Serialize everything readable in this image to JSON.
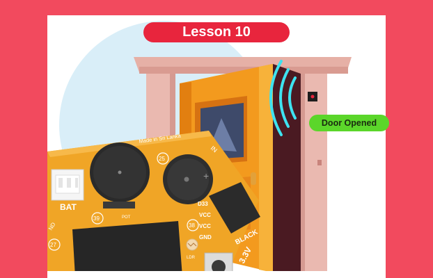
{
  "lesson_title": "Lesson 10",
  "status_badge": "Door Opened",
  "board": {
    "brand_text": "Made in Sri Lanka",
    "bat_label": "BAT",
    "pot_label": "POT",
    "ldr_label": "LDR",
    "pin_25": "25",
    "pin_39": "39",
    "pin_38": "38",
    "pin_27": "27",
    "pin_d33": "D33",
    "pin_vcc1": "VCC",
    "pin_vcc2": "VCC",
    "pin_gnd": "GND",
    "pin_nd": "ND",
    "black_label": "BLACK",
    "voltage_label": "3.3V",
    "in_label": "IN"
  },
  "colors": {
    "page_bg": "#f24a5e",
    "pill_bg": "#e8253d",
    "badge_bg": "#5bd62a",
    "board": "#f0a526",
    "door": "#f2931a",
    "frame": "#e8b7ae",
    "signal": "#3ee3f0"
  }
}
